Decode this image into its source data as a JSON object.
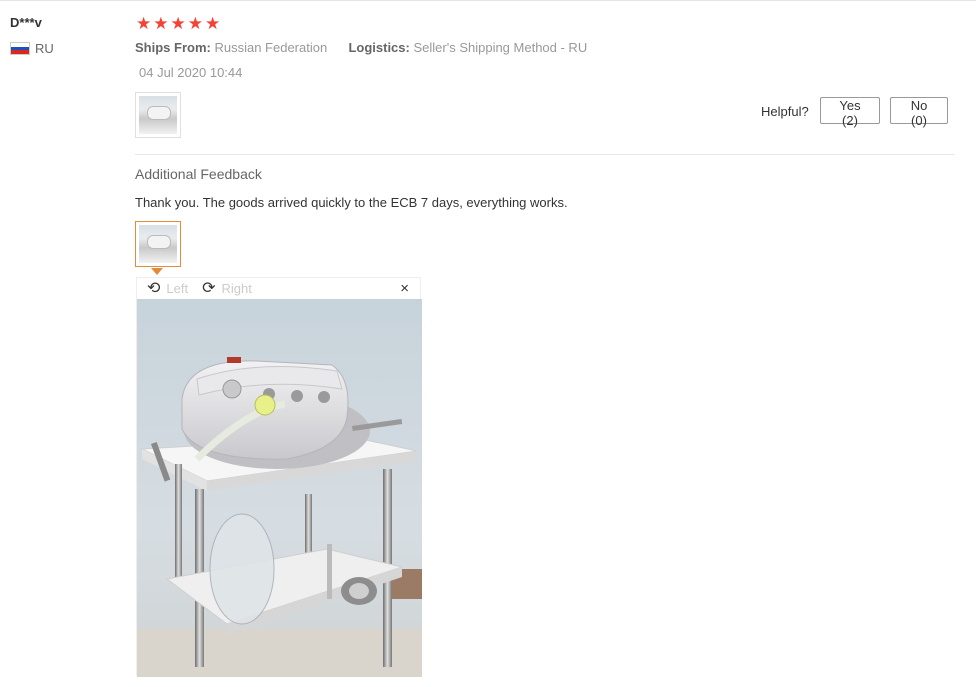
{
  "review": {
    "user_name": "D***v",
    "country_code": "RU",
    "rating": 5,
    "stars": [
      "★",
      "★",
      "★",
      "★",
      "★"
    ],
    "ships_from_label": "Ships From:",
    "ships_from_value": "Russian Federation",
    "logistics_label": "Logistics:",
    "logistics_value": "Seller's Shipping Method - RU",
    "date": "04 Jul 2020 10:44",
    "helpful_label": "Helpful?",
    "yes_label": "Yes (2)",
    "no_label": "No (0)"
  },
  "additional": {
    "title": "Additional Feedback",
    "text": "Thank you. The goods arrived quickly to the ECB 7 days, everything works."
  },
  "viewer": {
    "rotate_left_label": "Left",
    "rotate_right_label": "Right",
    "close_symbol": "×",
    "rotate_left_icon": "⟲",
    "rotate_right_icon": "⟳"
  },
  "colors": {
    "star": "#f44336",
    "thumb_active_border": "#e28b3c",
    "flag_white": "#ffffff",
    "flag_blue": "#1f4fbf",
    "flag_red": "#d52b1e"
  },
  "icons": {
    "flag": "russia-flag-icon",
    "rotate_left": "rotate-left-icon",
    "rotate_right": "rotate-right-icon",
    "close": "close-icon"
  }
}
